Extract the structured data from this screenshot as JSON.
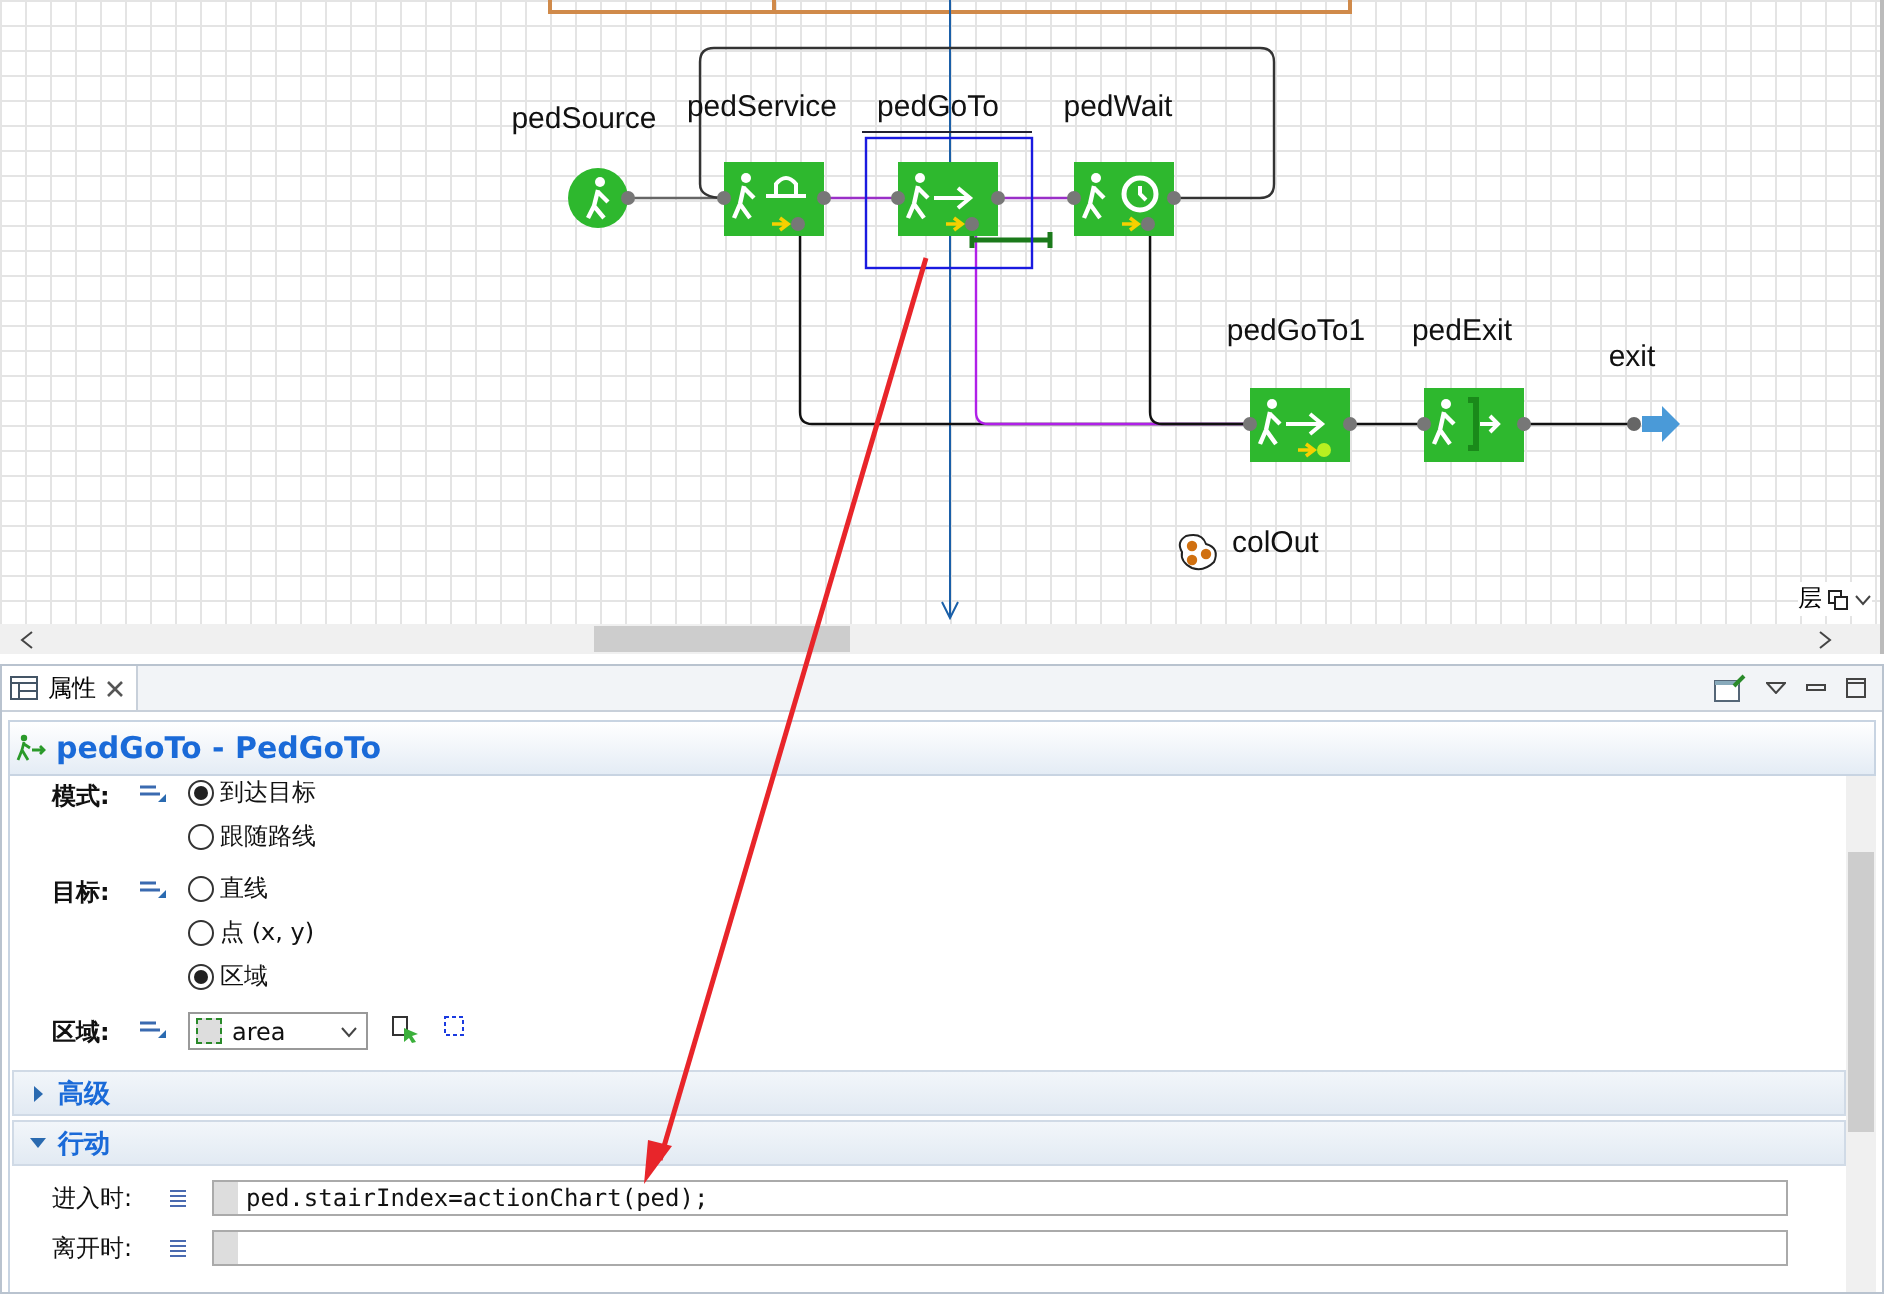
{
  "canvas": {
    "nodes": [
      {
        "label": "pedSource",
        "kind": "source",
        "selected": false
      },
      {
        "label": "pedService",
        "kind": "service",
        "selected": false
      },
      {
        "label": "pedGoTo",
        "kind": "goto",
        "selected": true
      },
      {
        "label": "pedWait",
        "kind": "wait",
        "selected": false
      },
      {
        "label": "pedGoTo1",
        "kind": "goto",
        "selected": false
      },
      {
        "label": "pedExit",
        "kind": "exit",
        "selected": false
      },
      {
        "label": "exit",
        "kind": "sink",
        "selected": false
      },
      {
        "label": "colOut",
        "kind": "collection",
        "selected": false
      }
    ],
    "layers_label": "层"
  },
  "properties": {
    "tab": "属性",
    "title": "pedGoTo - PedGoTo",
    "fields": [
      {
        "kind": "radio",
        "label": "模式:",
        "options": [
          {
            "label": "到达目标",
            "selected": true
          },
          {
            "label": "跟随路线",
            "selected": false
          }
        ]
      },
      {
        "kind": "radio",
        "label": "目标:",
        "options": [
          {
            "label": "直线",
            "selected": false
          },
          {
            "label": "点 (x, y)",
            "selected": false
          },
          {
            "label": "区域",
            "selected": true
          }
        ]
      },
      {
        "kind": "dropdown",
        "label": "区域:",
        "value": "area"
      }
    ],
    "sections": [
      {
        "title": "高级",
        "expanded": false
      },
      {
        "title": "行动",
        "expanded": true,
        "fields": [
          {
            "label": "进入时:",
            "value": "ped.stairIndex=actionChart(ped);"
          },
          {
            "label": "离开时:"
          }
        ]
      }
    ]
  }
}
